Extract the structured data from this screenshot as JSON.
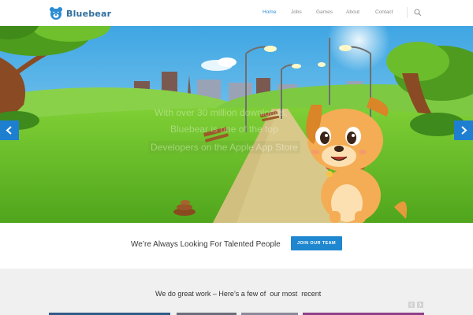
{
  "brand": {
    "name": "Bluebear",
    "icon": "bear-head-icon"
  },
  "nav": {
    "items": [
      {
        "label": "Home",
        "active": true
      },
      {
        "label": "Jobs",
        "active": false
      },
      {
        "label": "Games",
        "active": false
      },
      {
        "label": "About",
        "active": false
      },
      {
        "label": "Contact",
        "active": false
      }
    ],
    "search_icon": "search-icon"
  },
  "hero": {
    "caption_lines": [
      "With over 30 million downloads,",
      "Bluebear is one of the top",
      "Developers on the Apple App Store"
    ],
    "prev_icon": "chevron-left-icon",
    "next_icon": "chevron-right-icon"
  },
  "cta": {
    "text": "We’re Always Looking For Talented People",
    "button_label": "JOIN OUR TEAM"
  },
  "work": {
    "title": "We do great work – Here’s a few of  our most  recent",
    "prev_icon": "chevron-left-icon",
    "next_icon": "chevron-right-icon"
  },
  "colors": {
    "accent": "#1f87cf",
    "nav_active": "#2f8fd8",
    "sky": "#5ab7e8",
    "grass": "#6cc12b"
  }
}
